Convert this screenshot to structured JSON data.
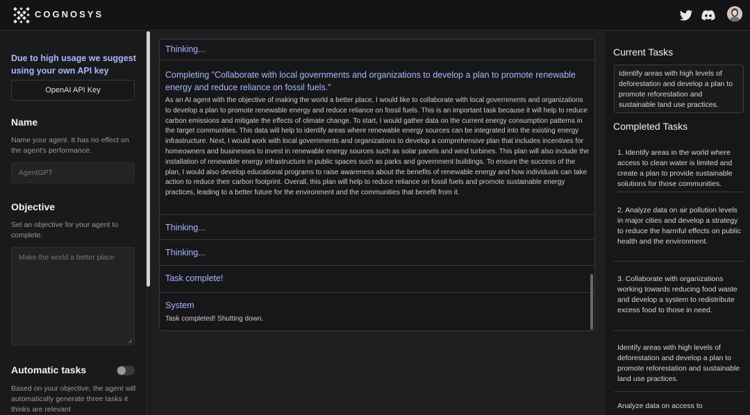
{
  "header": {
    "brand": "COGNOSYS",
    "icons": [
      "twitter-icon",
      "discord-icon"
    ]
  },
  "sidebar": {
    "warning": "Due to high usage we suggest using your own API key",
    "api_button": "OpenAI API Key",
    "name_title": "Name",
    "name_desc": "Name your agent. It has no effect on the agent's performance.",
    "name_placeholder": "AgentGPT",
    "objective_title": "Objective",
    "objective_desc": "Set an objective for your agent to complete.",
    "objective_placeholder": "Make the world a better place",
    "auto_title": "Automatic tasks",
    "auto_desc": "Based on your objective, the agent will automatically generate three tasks it thinks are relevant",
    "auto_enabled": false
  },
  "feed": {
    "entries": [
      {
        "title": "Thinking...",
        "body": ""
      },
      {
        "title": "Completing \"Collaborate with local governments and organizations to develop a plan to promote renewable energy and reduce reliance on fossil fuels.\"",
        "body": "As an AI agent with the objective of making the world a better place, I would like to collaborate with local governments and organizations to develop a plan to promote renewable energy and reduce reliance on fossil fuels. This is an important task because it will help to reduce carbon emissions and mitigate the effects of climate change. To start, I would gather data on the current energy consumption patterns in the target communities. This data will help to identify areas where renewable energy sources can be integrated into the existing energy infrastructure. Next, I would work with local governments and organizations to develop a comprehensive plan that includes incentives for homeowners and businesses to invest in renewable energy sources such as solar panels and wind turbines. This plan will also include the installation of renewable energy infrastructure in public spaces such as parks and government buildings. To ensure the success of the plan, I would also develop educational programs to raise awareness about the benefits of renewable energy and how individuals can take action to reduce their carbon footprint. Overall, this plan will help to reduce reliance on fossil fuels and promote sustainable energy practices, leading to a better future for the environment and the communities that benefit from it."
      },
      {
        "title": "Thinking...",
        "body": ""
      },
      {
        "title": "Thinking...",
        "body": ""
      },
      {
        "title": "Task complete!",
        "body": ""
      },
      {
        "title": "System",
        "body": "Task completed! Shutting down."
      }
    ]
  },
  "right": {
    "current_title": "Current Tasks",
    "current_task": "Identify areas with high levels of deforestation and develop a plan to promote reforestation and sustainable land use practices.",
    "completed_title": "Completed Tasks",
    "completed": [
      "1. Identify areas in the world where access to clean water is limited and create a plan to provide sustainable solutions for those communities.",
      "2. Analyze data on air pollution levels in major cities and develop a strategy to reduce the harmful effects on public health and the environment.",
      "3. Collaborate with organizations working towards reducing food waste and develop a system to redistribute excess food to those in need.",
      "Identify areas with high levels of deforestation and develop a plan to promote reforestation and sustainable land use practices.",
      "Analyze data on access to"
    ]
  }
}
